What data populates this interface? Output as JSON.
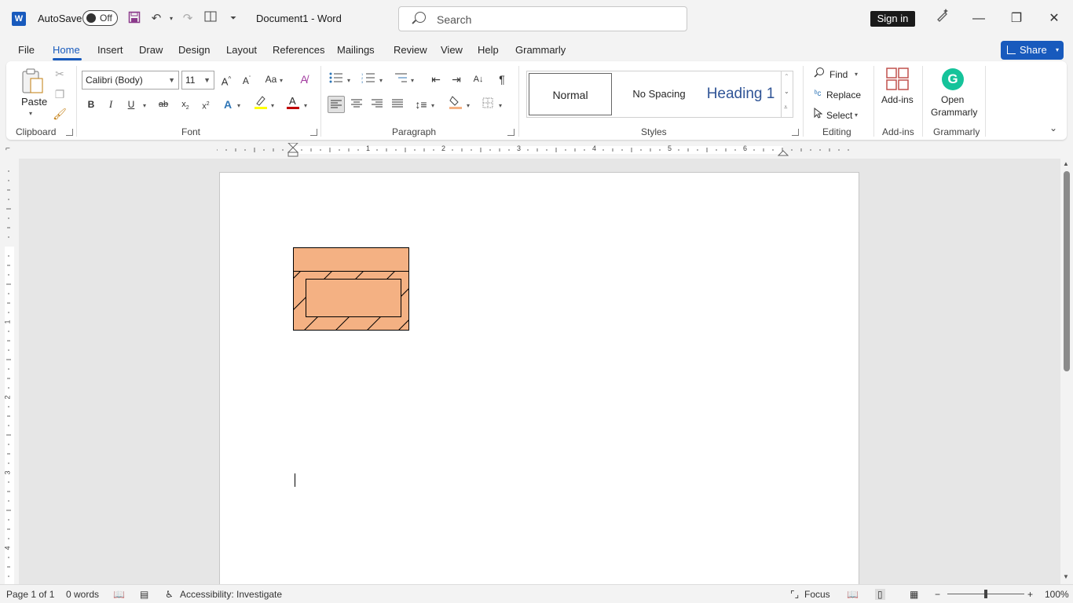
{
  "titlebar": {
    "autosave_label": "AutoSave",
    "autosave_state": "Off",
    "doc_title": "Document1  -  Word",
    "search_placeholder": "Search",
    "signin_label": "Sign in"
  },
  "menu": {
    "items": [
      "File",
      "Home",
      "Insert",
      "Draw",
      "Design",
      "Layout",
      "References",
      "Mailings",
      "Review",
      "View",
      "Help",
      "Grammarly"
    ],
    "active": "Home",
    "share_label": "Share"
  },
  "ribbon": {
    "clipboard": {
      "paste_label": "Paste",
      "group_label": "Clipboard"
    },
    "font": {
      "font_name": "Calibri (Body)",
      "font_size": "11",
      "group_label": "Font"
    },
    "paragraph": {
      "group_label": "Paragraph"
    },
    "styles": {
      "items": [
        "Normal",
        "No Spacing",
        "Heading 1"
      ],
      "group_label": "Styles"
    },
    "editing": {
      "find_label": "Find",
      "replace_label": "Replace",
      "select_label": "Select",
      "group_label": "Editing"
    },
    "addins": {
      "label": "Add-ins",
      "group_label": "Add-ins"
    },
    "grammarly": {
      "label_line1": "Open",
      "label_line2": "Grammarly",
      "group_label": "Grammarly"
    }
  },
  "ruler": {
    "numbers": [
      "1",
      "2",
      "3",
      "4",
      "5",
      "6"
    ]
  },
  "vruler": {
    "numbers": [
      "1",
      "2",
      "3",
      "4"
    ]
  },
  "document": {
    "shape_fill": "#f4b183",
    "shape_stroke": "#000000"
  },
  "status": {
    "page": "Page 1 of 1",
    "words": "0 words",
    "accessibility": "Accessibility: Investigate",
    "focus_label": "Focus",
    "zoom": "100%"
  },
  "colors": {
    "accent": "#185abd",
    "highlight": "#ffff00",
    "font_color": "#c00000",
    "grammarly": "#15c39a"
  }
}
